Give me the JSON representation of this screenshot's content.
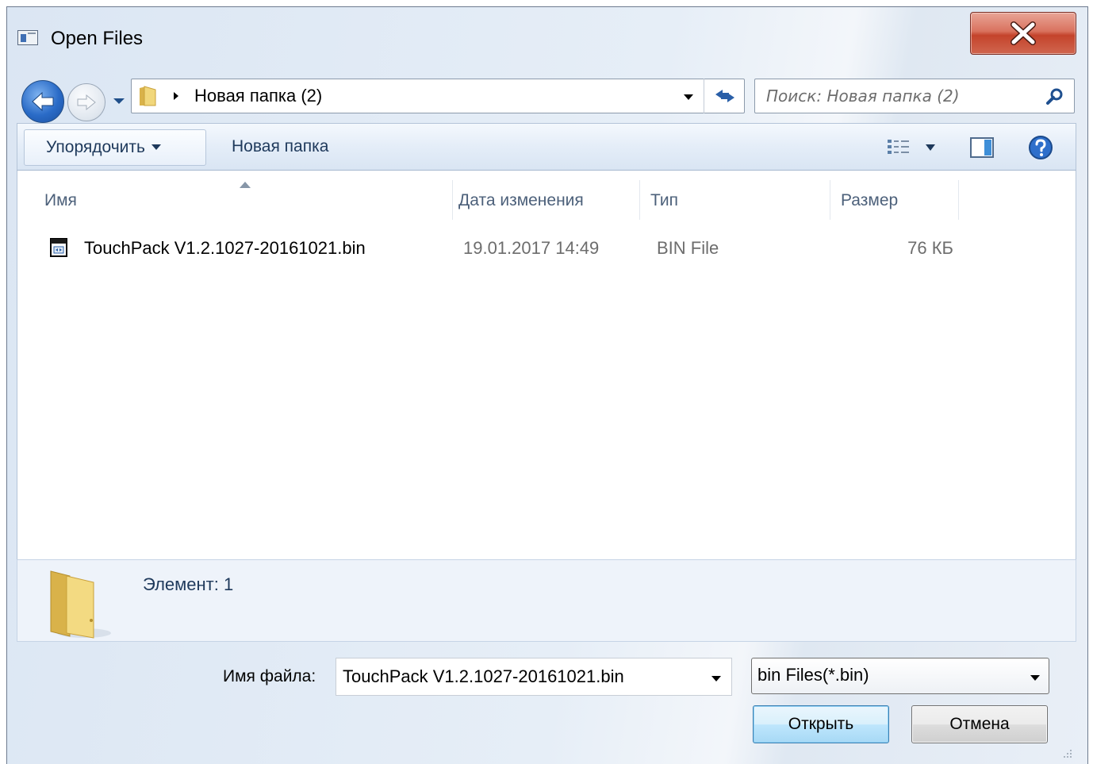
{
  "window": {
    "title": "Open Files",
    "close_glyph": "X"
  },
  "address_bar": {
    "path_segment": "Новая папка (2)"
  },
  "search": {
    "placeholder": "Поиск: Новая папка (2)"
  },
  "toolbar": {
    "organize_label": "Упорядочить",
    "new_folder_label": "Новая папка"
  },
  "columns": {
    "name": "Имя",
    "date": "Дата изменения",
    "type": "Тип",
    "size": "Размер"
  },
  "files": [
    {
      "name": "TouchPack V1.2.1027-20161021.bin",
      "date": "19.01.2017 14:49",
      "type": "BIN File",
      "size": "76 КБ"
    }
  ],
  "details": {
    "count_text": "Элемент: 1"
  },
  "footer": {
    "filename_label": "Имя файла:",
    "filename_value": "TouchPack V1.2.1027-20161021.bin",
    "filter_value": "bin Files(*.bin)",
    "open_label": "Открыть",
    "cancel_label": "Отмена"
  },
  "icons": {
    "back": "back-arrow-icon",
    "forward": "forward-arrow-icon",
    "folder": "folder-icon",
    "refresh": "refresh-icon",
    "search": "search-icon",
    "views": "views-icon",
    "preview_pane": "preview-pane-icon",
    "help": "help-icon",
    "file": "bin-file-icon"
  },
  "colors": {
    "accent_blue": "#2a6bc7",
    "close_red": "#c4432b",
    "link_text": "#1e395b"
  }
}
